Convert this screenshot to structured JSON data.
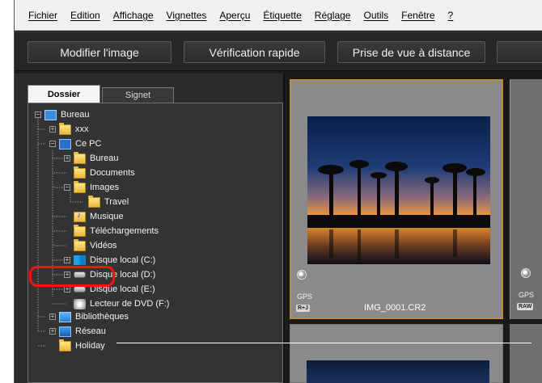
{
  "menu": [
    "Fichier",
    "Edition",
    "Affichage",
    "Vignettes",
    "Aperçu",
    "Étiquette",
    "Réglage",
    "Outils",
    "Fenêtre",
    "?"
  ],
  "toolbar": {
    "edit_label": "Modifier l'image",
    "quickcheck_label": "Vérification rapide",
    "remote_label": "Prise de vue à distance"
  },
  "tabs": {
    "folder": "Dossier",
    "bookmark": "Signet"
  },
  "tree": {
    "bureau_root": "Bureau",
    "xxx": "xxx",
    "ce_pc": "Ce PC",
    "bureau": "Bureau",
    "documents": "Documents",
    "images": "Images",
    "travel": "Travel",
    "musique": "Musique",
    "telechargements": "Téléchargements",
    "videos": "Vidéos",
    "disk_c": "Disque local (C:)",
    "disk_d": "Disque local (D:)",
    "disk_e": "Disque local (E:)",
    "dvd": "Lecteur de DVD (F:)",
    "bibliotheques": "Bibliothèques",
    "reseau": "Réseau",
    "holiday": "Holiday"
  },
  "thumbnails": {
    "first": {
      "gps": "GPS",
      "badge": "R+J",
      "filename": "IMG_0001.CR2"
    },
    "second": {
      "gps": "GPS",
      "badge": "RAW"
    }
  },
  "colors": {
    "highlight": "#ff1010",
    "selected_border": "#c08a3a"
  }
}
